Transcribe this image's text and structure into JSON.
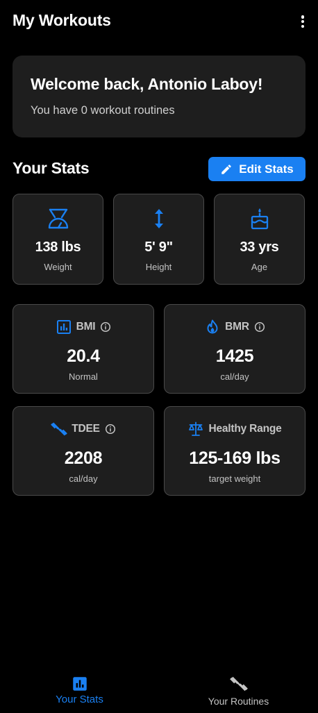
{
  "app_bar": {
    "title": "My Workouts",
    "menu_icon": "more-vert-icon"
  },
  "welcome": {
    "title": "Welcome back, Antonio Laboy!",
    "subtitle": "You have 0 workout routines"
  },
  "stats": {
    "heading": "Your Stats",
    "edit_button": "Edit Stats",
    "accent_color": "#1a80f2",
    "basic": [
      {
        "icon": "weight-scale-icon",
        "value": "138 lbs",
        "label": "Weight"
      },
      {
        "icon": "height-arrow-icon",
        "value": "5' 9\"",
        "label": "Height"
      },
      {
        "icon": "birthday-cake-icon",
        "value": "33 yrs",
        "label": "Age"
      }
    ],
    "metrics": [
      {
        "icon": "bar-chart-icon",
        "title": "BMI",
        "has_info": true,
        "value": "20.4",
        "label": "Normal"
      },
      {
        "icon": "flame-icon",
        "title": "BMR",
        "has_info": true,
        "value": "1425",
        "label": "cal/day"
      },
      {
        "icon": "dumbbell-icon",
        "title": "TDEE",
        "has_info": true,
        "value": "2208",
        "label": "cal/day"
      },
      {
        "icon": "balance-scale-icon",
        "title": "Healthy Range",
        "has_info": false,
        "value": "125-169 lbs",
        "label": "target weight"
      }
    ]
  },
  "bottom_nav": {
    "items": [
      {
        "label": "Your Stats",
        "icon": "bar-chart-icon",
        "active": true
      },
      {
        "label": "Your Routines",
        "icon": "dumbbell-icon",
        "active": false
      }
    ]
  }
}
